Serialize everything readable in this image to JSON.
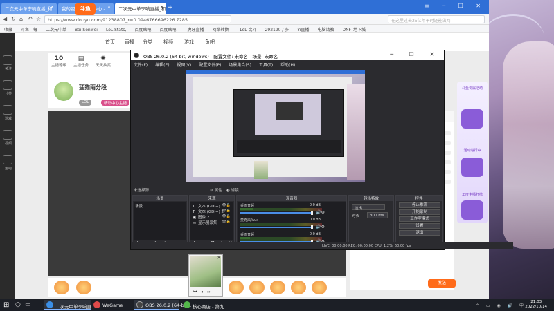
{
  "browser": {
    "tabs": [
      {
        "label": "二次元中单李响直播_和…"
      },
      {
        "label": "我的资料 - 个人中心 -…"
      },
      {
        "label": "二次元中单李响直播_和…"
      }
    ],
    "url": "https://www.douyu.com/91238807_r=0.0946766696226 7285",
    "search_placeholder": "在这里过去25亿年平时还能做两",
    "bookmarks": [
      "收藏",
      "斗鱼 - 每",
      "二次元中单",
      "Bai Senwei",
      "LoL Stats,",
      "百度贴吧",
      "百度贴吧 -",
      "虎牙直播",
      "网络转换 |",
      "LoL 比斗",
      "292190 / 多",
      "Yi直播",
      "电脑请教",
      "DNF_地下城"
    ]
  },
  "douyu": {
    "logo": "斗鱼",
    "nav": [
      "首页",
      "直播",
      "分类",
      "视频",
      "游戏",
      "鱼吧"
    ],
    "stats": [
      {
        "value": "10",
        "label": "主播等级"
      },
      {
        "value": "",
        "label": "主播任务"
      },
      {
        "value": "",
        "label": "天天抽奖"
      }
    ],
    "streamer_name": "猛猫雨分段",
    "tags": [
      "LOL",
      "精彩中心主播"
    ],
    "send_label": "发送",
    "sidebar": [
      "关注",
      "分类",
      "游戏",
      "视频",
      "鱼吧"
    ],
    "ad_labels": [
      "斗鱼专属活动",
      "活动进行中",
      "年度主播打榜"
    ]
  },
  "obs": {
    "title": "OBS 26.0.2 (64-bit, windows) - 配置文件: 未命名 - 场景: 未命名",
    "menu": [
      "文件(F)",
      "编辑(E)",
      "视图(V)",
      "配置文件(P)",
      "场景集合(S)",
      "工具(T)",
      "帮助(H)"
    ],
    "scene_line": "未选择源",
    "scene_props": "属性",
    "scene_filters": "滤镜",
    "docks": {
      "scenes": "场景",
      "sources": "来源",
      "mixer": "混音器",
      "transitions": "转场特效",
      "controls": "控件"
    },
    "scene_items": [
      "场景"
    ],
    "source_items": [
      {
        "icon": "T",
        "label": "文本 (GDI+)"
      },
      {
        "icon": "T",
        "label": "文本 (GDI+) 2"
      },
      {
        "icon": "▣",
        "label": "图像 2"
      },
      {
        "icon": "▭",
        "label": "显示器采集"
      }
    ],
    "mixer": [
      {
        "label": "桌面音频",
        "db": "0.0 dB",
        "level": 0.16
      },
      {
        "label": "麦克风/Aux",
        "db": "0.0 dB",
        "level": 0.0
      },
      {
        "label": "桌面音频",
        "db": "0.0 dB",
        "level": 0.12
      }
    ],
    "transition": {
      "select": "淡出",
      "duration_label": "时长",
      "duration": "300 ms"
    },
    "controls": [
      "停止推流",
      "开始录制",
      "工作室模式",
      "设置",
      "退出"
    ],
    "status": "LIVE: 00:00:00    REC: 00:00:00    CPU: 1.2%, 60.00 fps"
  },
  "taskbar": {
    "apps": [
      {
        "label": "二次元中单李响直...",
        "color": "#3a8ee6"
      },
      {
        "label": "WeGame",
        "color": "#e04a4a"
      },
      {
        "label": "OBS 26.0.2 (64-bit...",
        "color": "#444"
      },
      {
        "label": "核心商店 - 第九",
        "color": "#53b64a"
      }
    ],
    "time": "21:03",
    "date": "2022/10/14"
  },
  "colors": {
    "taskbar": "#1c1f26",
    "browser_tabbar": "#2f6fd6",
    "obs_bg": "#2b2b2f",
    "douyu_orange": "#ff6b1a"
  }
}
